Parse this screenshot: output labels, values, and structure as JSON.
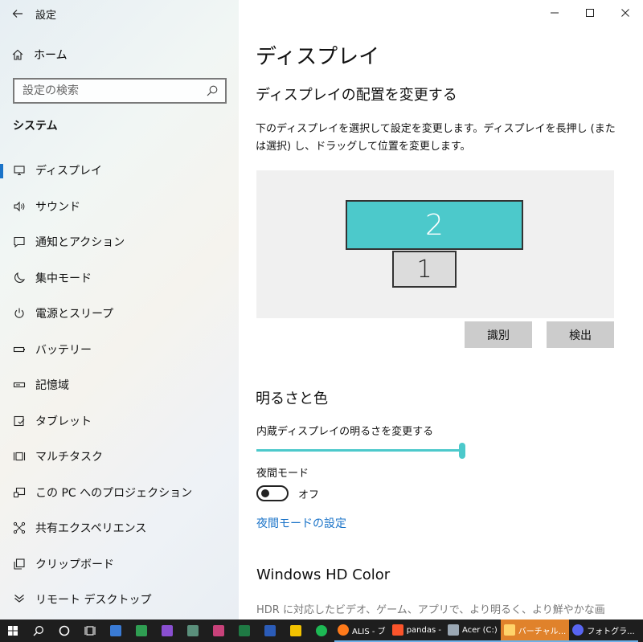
{
  "window": {
    "title": "設定",
    "back_icon": "arrow-left-icon",
    "controls": {
      "minimize": "—",
      "maximize": "☐",
      "close": "✕"
    }
  },
  "sidebar": {
    "home_label": "ホーム",
    "search_placeholder": "設定の検索",
    "section_title": "システム",
    "items": [
      {
        "label": "ディスプレイ",
        "icon": "monitor-icon",
        "active": true
      },
      {
        "label": "サウンド",
        "icon": "speaker-icon"
      },
      {
        "label": "通知とアクション",
        "icon": "message-icon"
      },
      {
        "label": "集中モード",
        "icon": "moon-icon"
      },
      {
        "label": "電源とスリープ",
        "icon": "power-icon"
      },
      {
        "label": "バッテリー",
        "icon": "battery-icon"
      },
      {
        "label": "記憶域",
        "icon": "storage-icon"
      },
      {
        "label": "タブレット",
        "icon": "tablet-icon"
      },
      {
        "label": "マルチタスク",
        "icon": "multitask-icon"
      },
      {
        "label": "この PC へのプロジェクション",
        "icon": "projection-icon"
      },
      {
        "label": "共有エクスペリエンス",
        "icon": "share-icon"
      },
      {
        "label": "クリップボード",
        "icon": "clipboard-icon"
      },
      {
        "label": "リモート デスクトップ",
        "icon": "remote-desktop-icon"
      }
    ]
  },
  "main": {
    "title": "ディスプレイ",
    "arrange": {
      "heading": "ディスプレイの配置を変更する",
      "description": "下のディスプレイを選択して設定を変更します。ディスプレイを長押し (または選択) し、ドラッグして位置を変更します。",
      "monitor_2_label": "2",
      "monitor_1_label": "1",
      "identify_label": "識別",
      "detect_label": "検出"
    },
    "brightness": {
      "heading": "明るさと色",
      "slider_label": "内蔵ディスプレイの明るさを変更する",
      "slider_value": 1.0,
      "night_mode_label": "夜間モード",
      "night_mode_state": "オフ",
      "night_mode_link": "夜間モードの設定"
    },
    "hdr": {
      "heading": "Windows HD Color",
      "description": "HDR に対応したビデオ、ゲーム、アプリで、より明るく、より鮮やかな画"
    }
  },
  "taskbar": {
    "apps": [
      {
        "label": "ALIS - ブ",
        "icon": "firefox-icon"
      },
      {
        "label": "pandas -",
        "icon": "brave-icon"
      },
      {
        "label": "Acer (C:)",
        "icon": "file-explorer-icon"
      },
      {
        "label": "バーチャル...",
        "icon": "folder-icon",
        "highlight": true
      },
      {
        "label": "フォトグラ...",
        "icon": "discord-icon"
      }
    ],
    "colors": {
      "background": "#1e1e1e",
      "accent": "#4cc9cb",
      "link": "#1a73c8",
      "highlight": "#e0822b"
    }
  }
}
